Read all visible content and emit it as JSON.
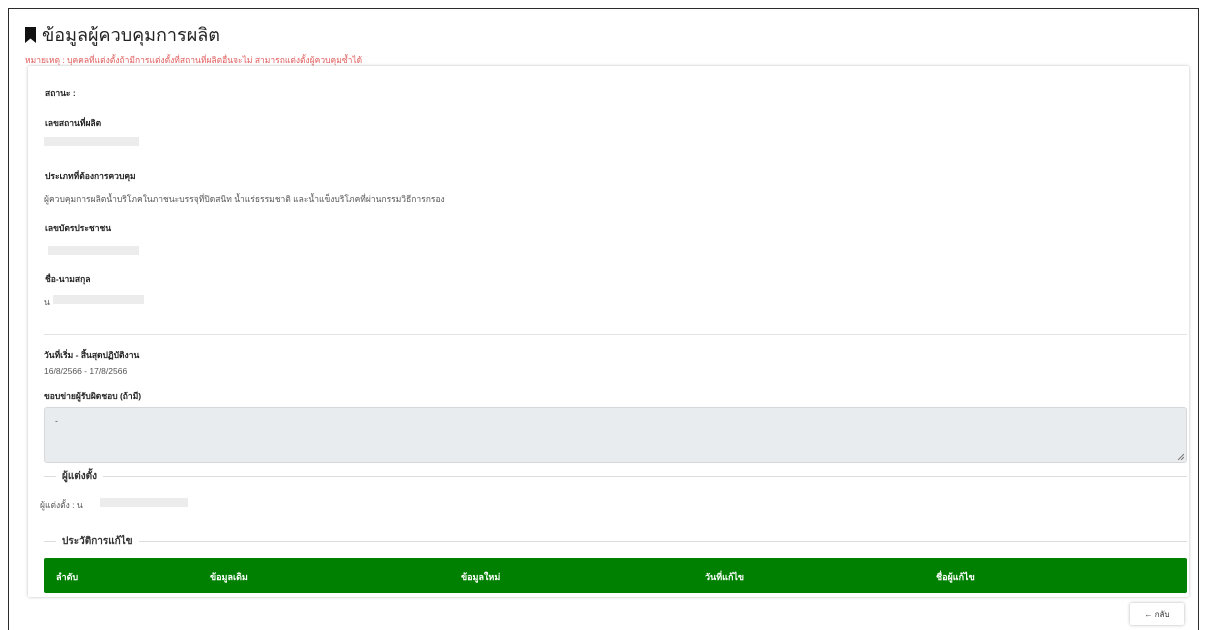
{
  "header": {
    "title": "ข้อมูลผู้ควบคุมการผลิต",
    "note": "หมายเหตุ : บุคคลที่แต่งตั้งถ้ามีการแต่งตั้งที่สถานที่ผลิตอื่นจะไม่ สามารถแต่งตั้งผู้ควบคุมซ้ำได้"
  },
  "details": {
    "status_label": "สถานะ :",
    "site_no_label": "เลขสถานที่ผลิต",
    "control_type_label": "ประเภทที่ต้องการควบคุม",
    "control_type_value": "ผู้ควบคุมการผลิตน้ำบริโภคในภาชนะบรรจุที่ปิดสนิท น้ำแร่ธรรมชาติ และน้ำแข็งบริโภคที่ผ่านกรรมวิธีการกรอง",
    "id_card_label": "เลขบัตรประชาชน",
    "name_label": "ชื่อ-นามสกุล",
    "name_value_prefix": "น",
    "period_label": "วันที่เริ่ม - สิ้นสุดปฏิบัติงาน",
    "period_value": "16/8/2566 - 17/8/2566",
    "scope_label": "ขอบข่ายผู้รับผิดชอบ (ถ้ามี)",
    "scope_value": "-"
  },
  "appointer": {
    "section_title": "ผู้แต่งตั้ง",
    "appointer_prefix": "ผู้แต่งตั้ง : น"
  },
  "history": {
    "section_title": "ประวัติการแก้ไข",
    "columns": [
      "ลำดับ",
      "ข้อมูลเดิม",
      "ข้อมูลใหม่",
      "วันที่แก้ไข",
      "ชื่อผู้แก้ไข"
    ]
  },
  "footer": {
    "back_label": "← กลับ"
  },
  "colors": {
    "table_header": "#008000",
    "note_text": "#e05a5a",
    "textarea_bg": "#e9ecef"
  }
}
